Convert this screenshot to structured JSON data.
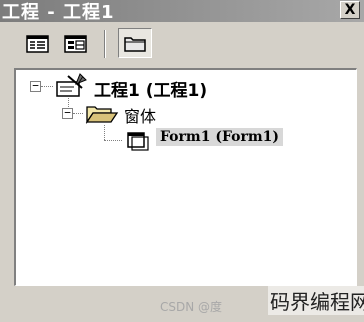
{
  "window": {
    "title": "工程 - 工程1",
    "close_label": "X"
  },
  "toolbar": {
    "buttons": [
      {
        "icon": "view-code-icon"
      },
      {
        "icon": "view-object-icon"
      },
      {
        "icon": "toggle-folders-icon",
        "pressed": true
      }
    ]
  },
  "tree": {
    "project": {
      "label": "工程1 (工程1)",
      "expanded": true,
      "icon": "vb-project-icon"
    },
    "forms_folder": {
      "label": "窗体",
      "expanded": true,
      "icon": "open-folder-icon"
    },
    "form": {
      "label": "Form1 (Form1)",
      "selected": true,
      "icon": "form-icon"
    }
  },
  "watermark": {
    "csdn": "CSDN @度",
    "site": "码界编程网"
  },
  "colors": {
    "face": "#d4d0c8",
    "titlebar_inactive": "#8c8c8c",
    "selection": "#d8d8d8"
  }
}
